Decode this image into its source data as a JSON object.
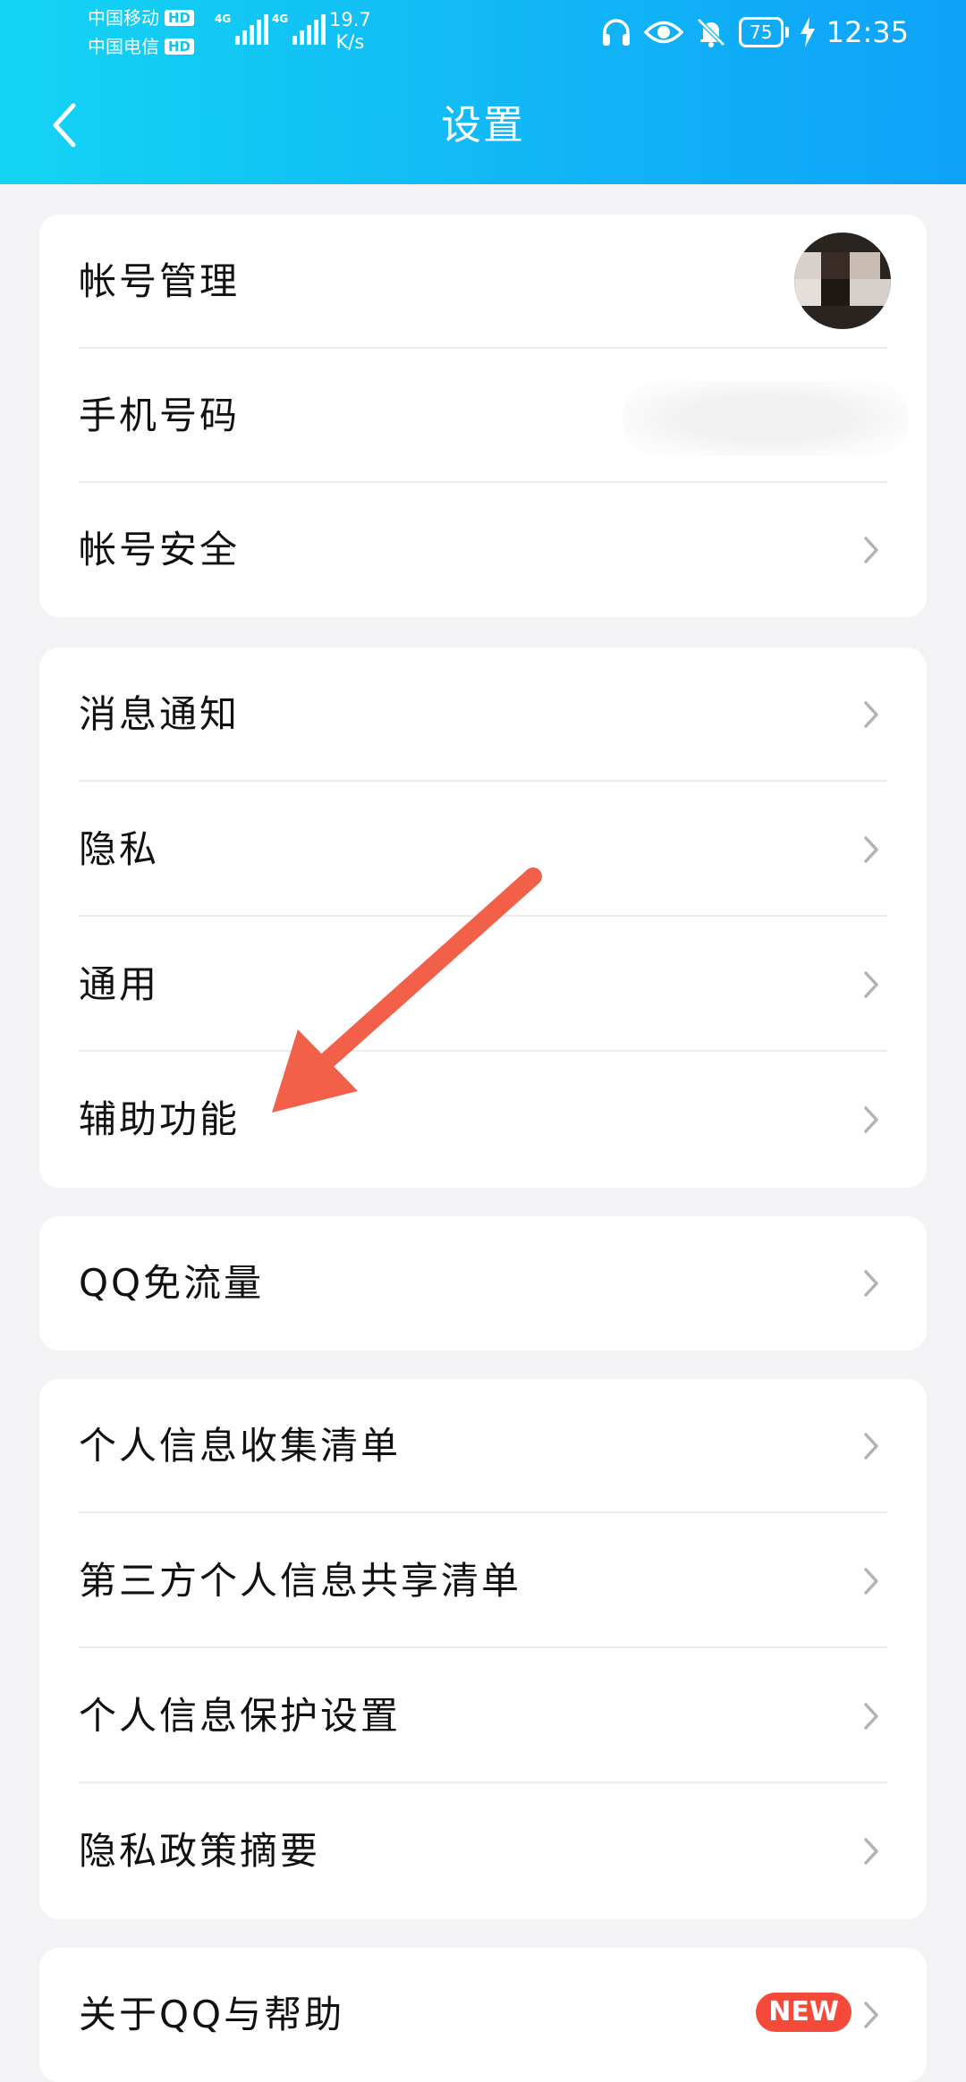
{
  "status_bar": {
    "carrier1": "中国移动",
    "carrier2": "中国电信",
    "hd_label": "HD",
    "network_type": "4G",
    "speed_value": "19.7",
    "speed_unit": "K/s",
    "battery": "75",
    "time": "12:35",
    "icons": [
      "headphones-icon",
      "eye-icon",
      "bell-off-icon",
      "battery-icon",
      "charging-icon"
    ]
  },
  "header": {
    "title": "设置",
    "back_icon": "chevron-left-icon"
  },
  "groups": [
    {
      "items": [
        {
          "label": "帐号管理"
        },
        {
          "label": "手机号码"
        },
        {
          "label": "帐号安全"
        }
      ]
    },
    {
      "items": [
        {
          "label": "消息通知"
        },
        {
          "label": "隐私"
        },
        {
          "label": "通用"
        },
        {
          "label": "辅助功能"
        }
      ]
    },
    {
      "items": [
        {
          "label": "QQ免流量"
        }
      ]
    },
    {
      "items": [
        {
          "label": "个人信息收集清单"
        },
        {
          "label": "第三方个人信息共享清单"
        },
        {
          "label": "个人信息保护设置"
        },
        {
          "label": "隐私政策摘要"
        }
      ]
    },
    {
      "items": [
        {
          "label": "关于QQ与帮助",
          "badge": "NEW"
        }
      ]
    }
  ],
  "colors": {
    "header_start": "#13d5f3",
    "header_end": "#0ea2f8",
    "annotation_arrow": "#f2604a",
    "badge": "#f54a3a"
  }
}
